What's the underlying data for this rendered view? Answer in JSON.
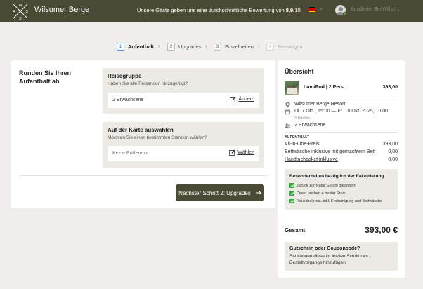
{
  "header": {
    "logo_letters": [
      "W",
      "S",
      "B",
      "A"
    ],
    "brand": "Wilsumer Berge",
    "rating_prefix": "Unsere Gäste geben uns eine durchschnittliche Bewertung von ",
    "rating_value": "8,9",
    "rating_suffix": "/10",
    "language_flag": "de-flag-icon",
    "account_label": "Ansdirken Bei Willst!",
    "colors": {
      "bar": "#4a4a35",
      "online": "#2fb24a"
    }
  },
  "steps": [
    {
      "num": "1",
      "label": "Aufenthalt",
      "state": "active"
    },
    {
      "num": "2",
      "label": "Upgrades",
      "state": "normal"
    },
    {
      "num": "3",
      "label": "Einzelheiten",
      "state": "normal"
    },
    {
      "num": "4",
      "label": "Bestätigen",
      "state": "disabled"
    }
  ],
  "booking": {
    "title": "Runden Sie Ihren Aufenthalt ab",
    "travel_group": {
      "heading": "Reisegruppe",
      "subtitle": "Haben Sie alle Reisenden hinzugefügt?",
      "value": "2 Erwachsene",
      "action": "Ändern"
    },
    "map_select": {
      "heading": "Auf der Karte auswählen",
      "subtitle": "Möchten Sie einen bestimmten Standort wählen?",
      "value": "Keine Präferenz",
      "action": "Wählen"
    },
    "next_button": "Nächster Schritt 2: Upgrades"
  },
  "overview": {
    "title": "Übersicht",
    "product_name": "LumiPod | 2 Pers.",
    "product_price": "393,00",
    "location": "Wilsumer Berge Resort",
    "dates": "Di. 7 Okt., 15:00 — Fr. 10 Okt. 2025, 10:00",
    "nights": "3 Nächte",
    "guests": "2 Erwachsene",
    "section_label": "AUFENTHALT",
    "lines": [
      {
        "label": "All-in-One-Preis",
        "value": "393,00",
        "link": false
      },
      {
        "label": "Bettwäsche inklusive mit gemachtem Bett",
        "value": "0,00",
        "link": true
      },
      {
        "label": "Handtuchpaket inklusive",
        "value": "0,00",
        "link": true
      }
    ],
    "billing": {
      "heading": "Besonderheiten bezüglich der Fakturierung",
      "items": [
        "Zurück zur Natur Gefühl garantiert",
        "Direkt buchen = bester Preis",
        "Pauschalpreis, inkl. Endreinigung und Bettwäsche"
      ]
    },
    "total_label": "Gesamt",
    "total_value": "393,00 €",
    "coupon": {
      "heading": "Gutschein oder Couponcode?",
      "text": "Sie können diese im letzten Schritt des Bestellvorgangs hinzufügen."
    }
  }
}
